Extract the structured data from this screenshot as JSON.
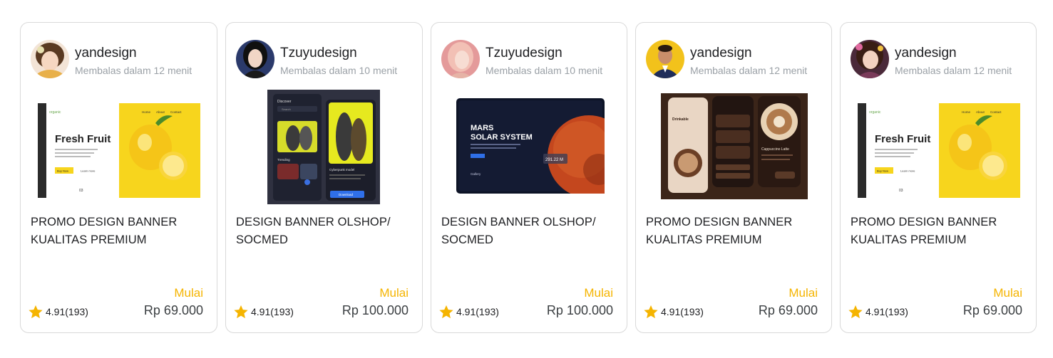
{
  "accent_color": "#f5b400",
  "cards": [
    {
      "seller": "yandesign",
      "reply": "Membalas dalam 12 menit",
      "title": "PROMO DESIGN  BANNER KUALITAS PREMIUM",
      "price_prefix": "Mulai",
      "price": "Rp 69.000",
      "rating": "4.91(193)",
      "rating_icon": "star-icon",
      "thumb_text": {
        "logo": "organic",
        "heading": "Fresh Fruit",
        "nav": [
          "Home",
          "About",
          "Contact"
        ],
        "cta": "Buy Now",
        "link": "Learn more",
        "counter": "03"
      }
    },
    {
      "seller": "Tzuyudesign",
      "reply": "Membalas dalam 10 menit",
      "title": " DESIGN  BANNER OLSHOP/ SOCMED",
      "price_prefix": "Mulai",
      "price": "Rp 100.000",
      "rating": "4.91(193)",
      "rating_icon": "star-icon",
      "thumb_text": {
        "discover": "Discover",
        "search": "Search",
        "trending": "Trending",
        "card_title": "Cyberpunk model",
        "button": "Download"
      }
    },
    {
      "seller": "Tzuyudesign",
      "reply": "Membalas dalam 10 menit",
      "title": " DESIGN  BANNER OLSHOP/ SOCMED",
      "price_prefix": "Mulai",
      "price": "Rp 100.000",
      "rating": "4.91(193)",
      "rating_icon": "star-icon",
      "thumb_text": {
        "heading1": "MARS",
        "heading2": "SOLAR SYSTEM",
        "readout": "291.22 M",
        "gallery": "Gallery"
      }
    },
    {
      "seller": "yandesign",
      "reply": "Membalas dalam 12 menit",
      "title": "PROMO DESIGN  BANNER KUALITAS PREMIUM",
      "price_prefix": "Mulai",
      "price": "Rp 69.000",
      "rating": "4.91(193)",
      "rating_icon": "star-icon",
      "thumb_text": {
        "screen1": "Drinkable",
        "screen3": "Cappuccino Latte"
      }
    },
    {
      "seller": "yandesign",
      "reply": "Membalas dalam 12 menit",
      "title": "PROMO DESIGN  BANNER KUALITAS PREMIUM",
      "price_prefix": "Mulai",
      "price": "Rp 69.000",
      "rating": "4.91(193)",
      "rating_icon": "star-icon",
      "thumb_text": {
        "logo": "organic",
        "heading": "Fresh Fruit",
        "nav": [
          "Home",
          "About",
          "Contact"
        ],
        "cta": "Buy Now",
        "link": "Learn more",
        "counter": "03"
      }
    }
  ]
}
